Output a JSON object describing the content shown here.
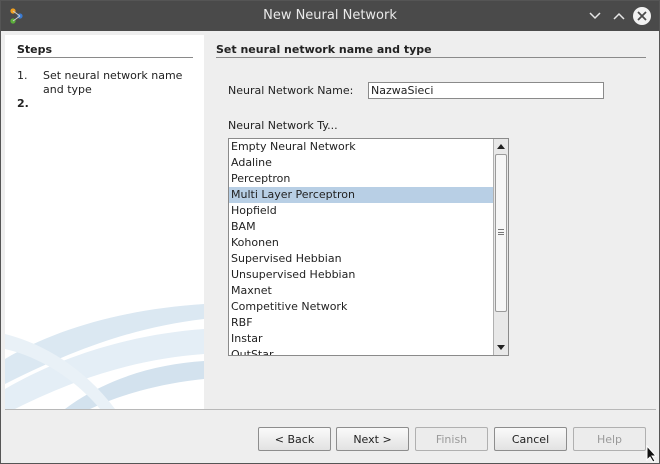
{
  "window": {
    "title": "New Neural Network"
  },
  "icons": {
    "app": "netbeans-app-icon",
    "minimize": "chevron-down-icon",
    "maximize": "chevron-up-icon",
    "close": "close-icon"
  },
  "steps": {
    "heading": "Steps",
    "items": [
      {
        "number": "1.",
        "label": "Set neural network name and type"
      },
      {
        "number": "2.",
        "label": ""
      }
    ]
  },
  "content": {
    "heading": "Set neural network name and type",
    "name_label": "Neural Network Name:",
    "name_value": "NazwaSieci",
    "type_label": "Neural Network Ty...",
    "types": [
      "Empty Neural Network",
      "Adaline",
      "Perceptron",
      "Multi Layer Perceptron",
      "Hopfield",
      "BAM",
      "Kohonen",
      "Supervised Hebbian",
      "Unsupervised Hebbian",
      "Maxnet",
      "Competitive Network",
      "RBF",
      "Instar",
      "OutStar"
    ],
    "selected_type": "Multi Layer Perceptron"
  },
  "buttons": {
    "back": "< Back",
    "next": "Next >",
    "finish": "Finish",
    "cancel": "Cancel",
    "help": "Help"
  },
  "colors": {
    "titlebar": "#4a4a4a",
    "selection": "#b8cfe5",
    "panel": "#eeeeee"
  }
}
